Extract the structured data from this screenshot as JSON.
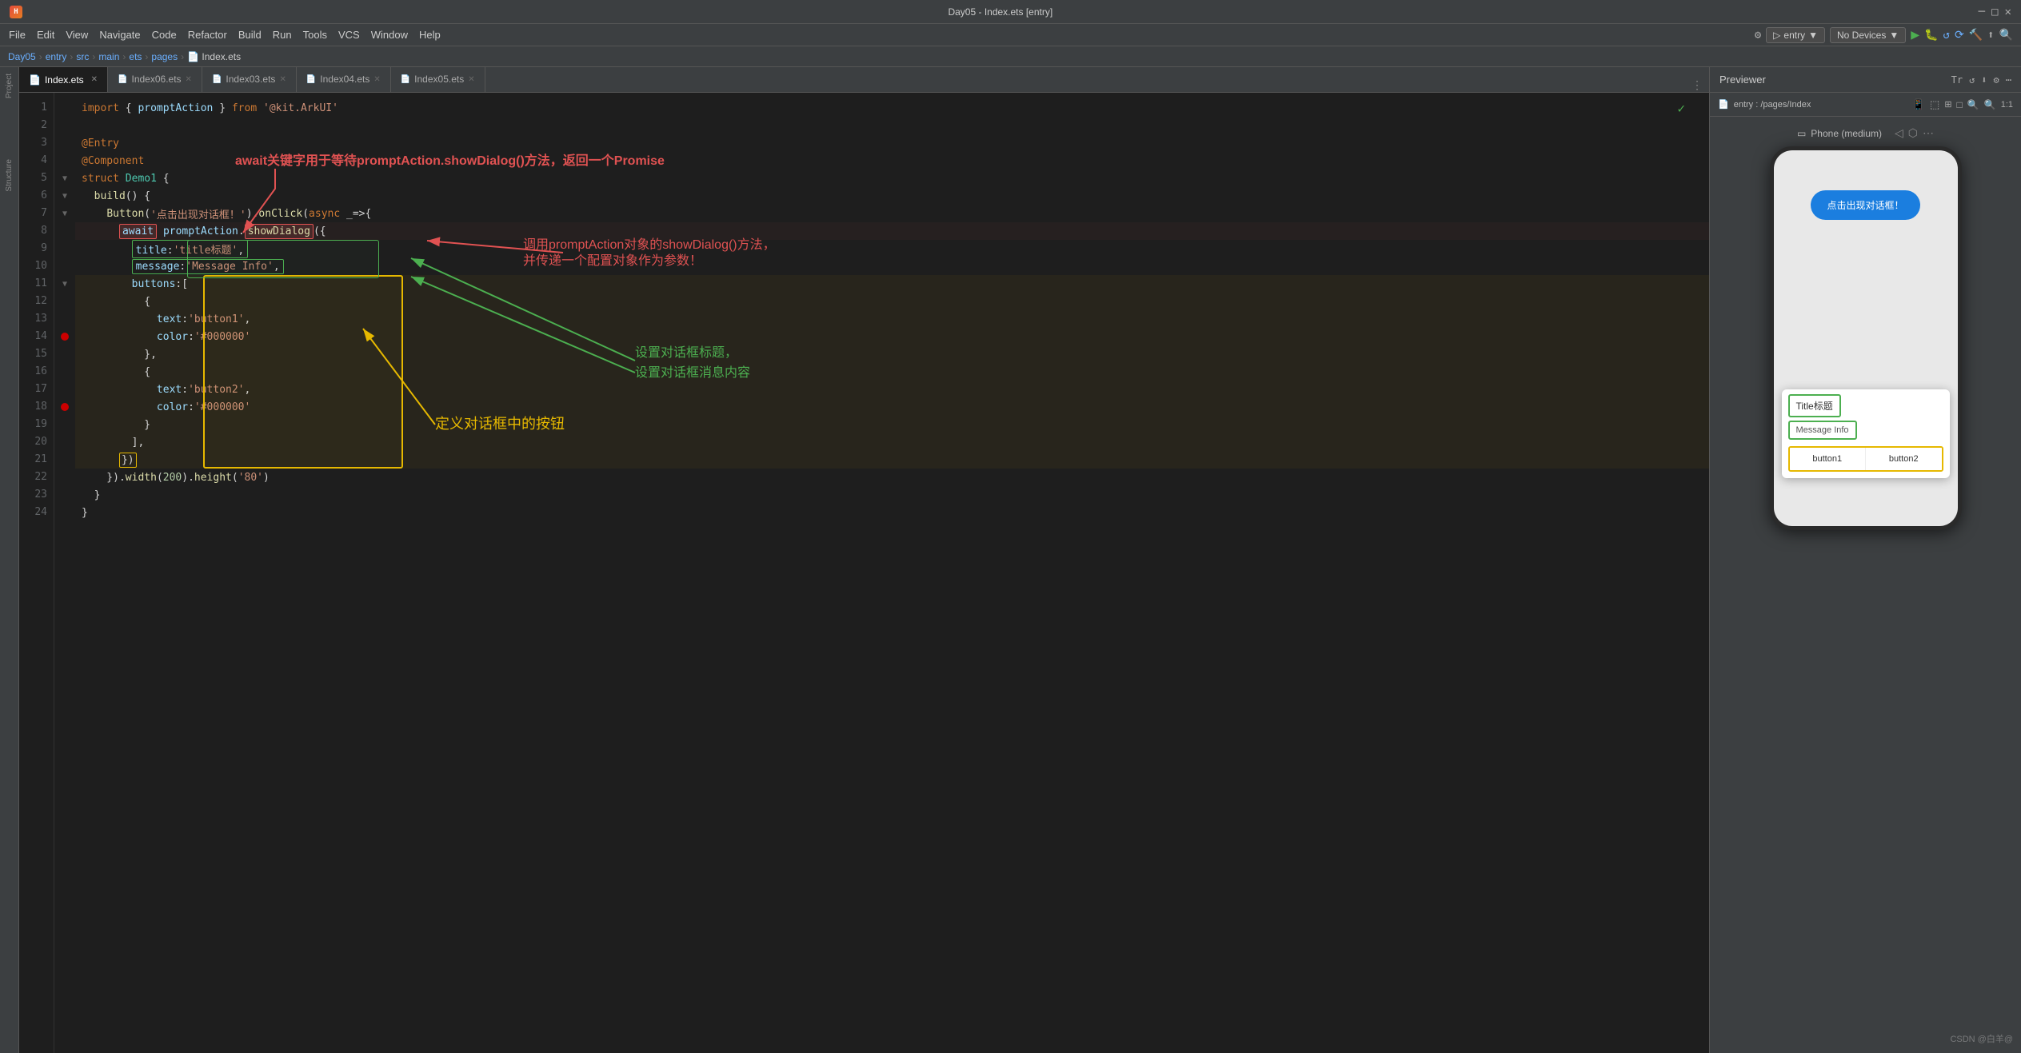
{
  "titlebar": {
    "title": "Day05 - Index.ets [entry]",
    "controls": [
      "minimize",
      "maximize",
      "close"
    ]
  },
  "menubar": {
    "items": [
      "File",
      "Edit",
      "View",
      "Navigate",
      "Code",
      "Refactor",
      "Build",
      "Run",
      "Tools",
      "VCS",
      "Window",
      "Help"
    ]
  },
  "breadcrumb": {
    "parts": [
      "Day05",
      "entry",
      "src",
      "main",
      "ets",
      "pages",
      "Index.ets"
    ]
  },
  "tabs": [
    {
      "label": "Index.ets",
      "active": true
    },
    {
      "label": "Index06.ets",
      "active": false
    },
    {
      "label": "Index03.ets",
      "active": false
    },
    {
      "label": "Index04.ets",
      "active": false
    },
    {
      "label": "Index05.ets",
      "active": false
    }
  ],
  "toolbar": {
    "entry_label": "entry",
    "no_devices_label": "No Devices",
    "search_icon": "🔍",
    "settings_icon": "⚙"
  },
  "annotations": {
    "red1": "await关键字用于等待promptAction.showDialog()方法，返回一个Promise",
    "red2": "调用promptAction对象的showDialog()方法，并传递一个配置对象作为参数！",
    "green1": "设置对话框标题，设置对话框消息内容",
    "orange1": "定义对话框中的按钮"
  },
  "code_lines": [
    {
      "num": 1,
      "content": "  import { promptAction } from '@kit.ArkUI'"
    },
    {
      "num": 2,
      "content": ""
    },
    {
      "num": 3,
      "content": "  @Entry"
    },
    {
      "num": 4,
      "content": "  @Component"
    },
    {
      "num": 5,
      "content": "  struct Demo1 {"
    },
    {
      "num": 6,
      "content": "    build() {"
    },
    {
      "num": 7,
      "content": "      Button('点击出现对话框！').onClick(async _=>{"
    },
    {
      "num": 8,
      "content": "        await promptAction.showDialog({"
    },
    {
      "num": 9,
      "content": "          title:'title标题',"
    },
    {
      "num": 10,
      "content": "          message:'Message Info',"
    },
    {
      "num": 11,
      "content": "          buttons:["
    },
    {
      "num": 12,
      "content": "            {"
    },
    {
      "num": 13,
      "content": "              text:'button1',"
    },
    {
      "num": 14,
      "content": "              color:'#000000'"
    },
    {
      "num": 15,
      "content": "            },"
    },
    {
      "num": 16,
      "content": "            {"
    },
    {
      "num": 17,
      "content": "              text:'button2',"
    },
    {
      "num": 18,
      "content": "              color:'#000000'"
    },
    {
      "num": 19,
      "content": "            }"
    },
    {
      "num": 20,
      "content": "          ],"
    },
    {
      "num": 21,
      "content": "        })"
    },
    {
      "num": 22,
      "content": "      }).width(200).height('80')"
    },
    {
      "num": 23,
      "content": "    }"
    },
    {
      "num": 24,
      "content": "  }"
    }
  ],
  "previewer": {
    "title": "Previewer",
    "path": "entry : /pages/Index",
    "phone_label": "Phone (medium)",
    "button_text": "点击出现对话框！",
    "dialog": {
      "title": "Title标题",
      "message": "Message Info",
      "button1": "button1",
      "button2": "button2"
    },
    "watermark": "CSDN @白羊@"
  },
  "sidebar_items": [
    "Project",
    "Structure"
  ]
}
